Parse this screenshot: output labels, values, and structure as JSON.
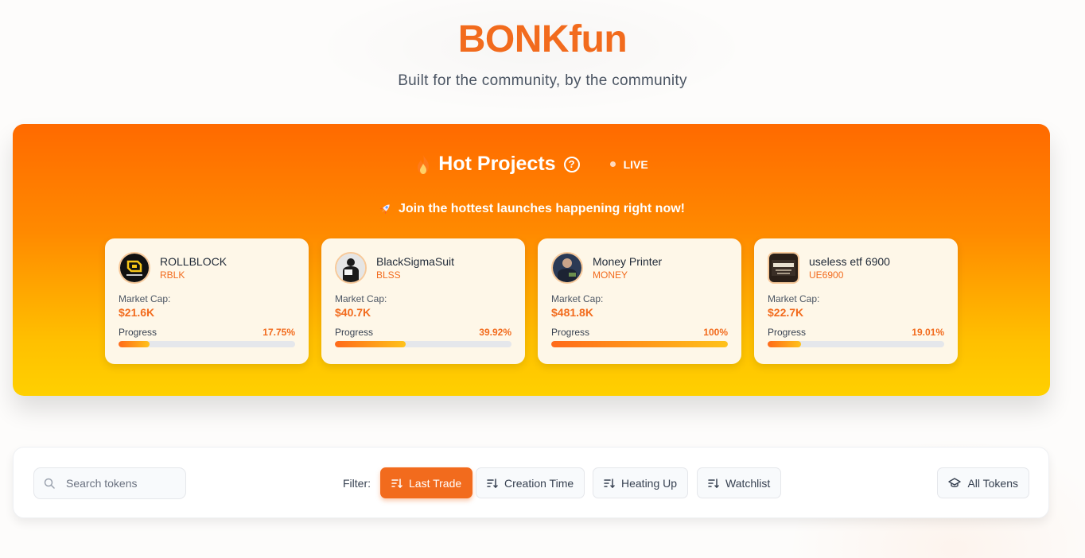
{
  "header": {
    "brand": "BONKfun",
    "tagline": "Built for the community, by the community"
  },
  "hot": {
    "title": "Hot Projects",
    "help_glyph": "?",
    "live_label": "LIVE",
    "subtitle": "Join the hottest launches happening right now!",
    "cards": [
      {
        "name": "ROLLBLOCK",
        "ticker": "RBLK",
        "market_cap_label": "Market Cap:",
        "market_cap": "$21.6K",
        "progress_label": "Progress",
        "progress_text": "17.75%",
        "progress": 17.75
      },
      {
        "name": "BlackSigmaSuit",
        "ticker": "BLSS",
        "market_cap_label": "Market Cap:",
        "market_cap": "$40.7K",
        "progress_label": "Progress",
        "progress_text": "39.92%",
        "progress": 39.92
      },
      {
        "name": "Money Printer",
        "ticker": "MONEY",
        "market_cap_label": "Market Cap:",
        "market_cap": "$481.8K",
        "progress_label": "Progress",
        "progress_text": "100%",
        "progress": 100
      },
      {
        "name": "useless etf 6900",
        "ticker": "UE6900",
        "market_cap_label": "Market Cap:",
        "market_cap": "$22.7K",
        "progress_label": "Progress",
        "progress_text": "19.01%",
        "progress": 19.01
      }
    ]
  },
  "filters": {
    "search_placeholder": "Search tokens",
    "label": "Filter:",
    "options": [
      "Last Trade",
      "Creation Time",
      "Heating Up",
      "Watchlist"
    ],
    "active": "Last Trade",
    "all_tokens": "All Tokens"
  },
  "colors": {
    "brand": "#f26b1d",
    "panel_top": "#ff6a00",
    "panel_bottom": "#ffd000",
    "card_bg": "#fef7e8"
  }
}
